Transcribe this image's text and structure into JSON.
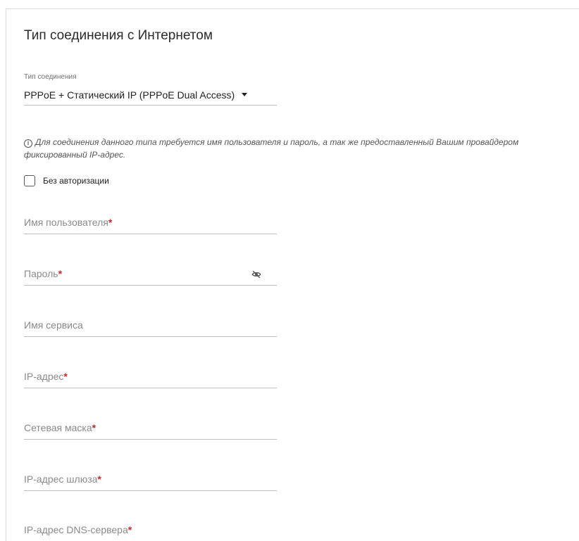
{
  "section": {
    "title": "Тип соединения с Интернетом"
  },
  "connection_type": {
    "caption": "Тип соединения",
    "selected": "PPPoE + Статический IP (PPPoE Dual Access)"
  },
  "info": {
    "icon": "info-icon",
    "text": "Для соединения данного типа требуется имя пользователя и пароль, а так же предоставленный Вашим провайдером фиксированный IP-адрес."
  },
  "no_auth": {
    "label": "Без авторизации",
    "checked": false
  },
  "fields": {
    "username": {
      "label": "Имя пользователя",
      "required": "*",
      "value": ""
    },
    "password": {
      "label": "Пароль",
      "required": "*",
      "value": "",
      "icon": "eye-off-icon"
    },
    "service_name": {
      "label": "Имя сервиса",
      "value": ""
    },
    "ip_address": {
      "label": "IP-адрес",
      "required": "*",
      "value": ""
    },
    "netmask": {
      "label": "Сетевая маска",
      "required": "*",
      "value": ""
    },
    "gateway": {
      "label": "IP-адрес шлюза",
      "required": "*",
      "value": ""
    },
    "dns": {
      "label": "IP-адрес DNS-сервера",
      "required": "*",
      "value": ""
    }
  },
  "colors": {
    "required_mark": "#c62828",
    "underline": "#bdbdbd",
    "border_rule": "#d6dbe0"
  }
}
